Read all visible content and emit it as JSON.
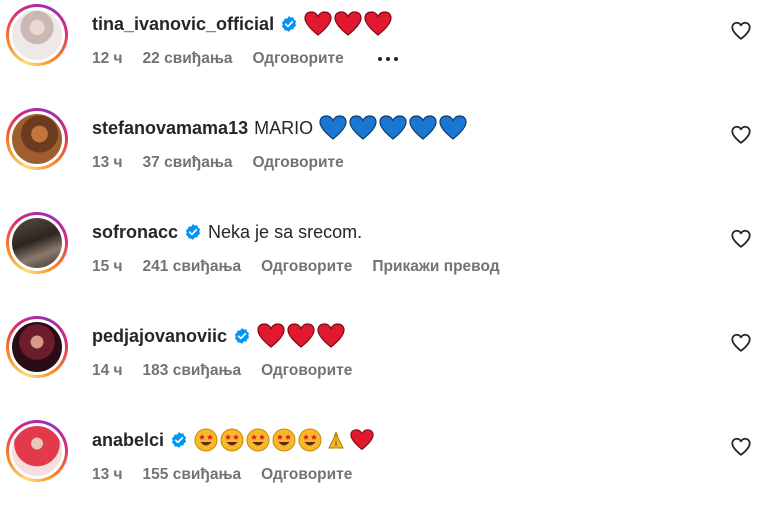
{
  "comments": [
    {
      "username": "tina_ivanovic_official",
      "verified": true,
      "text": "",
      "emojis": [
        "red-heart",
        "red-heart",
        "red-heart"
      ],
      "time": "12 ч",
      "likes": "22 свиђања",
      "reply_label": "Одговорите",
      "has_more": true,
      "translate_label": ""
    },
    {
      "username": "stefanovamama13",
      "verified": false,
      "text": "MARIO",
      "emojis": [
        "blue-heart",
        "blue-heart",
        "blue-heart",
        "blue-heart",
        "blue-heart"
      ],
      "time": "13 ч",
      "likes": "37 свиђања",
      "reply_label": "Одговорите",
      "has_more": false,
      "translate_label": ""
    },
    {
      "username": "sofronacc",
      "verified": true,
      "text": "Neka je sa srecom.",
      "emojis": [],
      "time": "15 ч",
      "likes": "241 свиђања",
      "reply_label": "Одговорите",
      "has_more": false,
      "translate_label": "Прикажи превод"
    },
    {
      "username": "pedjajovanoviic",
      "verified": true,
      "text": "",
      "emojis": [
        "red-heart",
        "red-heart",
        "red-heart"
      ],
      "time": "14 ч",
      "likes": "183 свиђања",
      "reply_label": "Одговорите",
      "has_more": false,
      "translate_label": ""
    },
    {
      "username": "anabelci",
      "verified": true,
      "text": "",
      "emojis": [
        "star-struck",
        "star-struck",
        "star-struck",
        "star-struck",
        "star-struck",
        "folded-hands",
        "red-heart"
      ],
      "time": "13 ч",
      "likes": "155 свиђања",
      "reply_label": "Одговорите",
      "has_more": false,
      "translate_label": ""
    }
  ],
  "colors": {
    "verified_blue": "#0095f6",
    "red_heart": "#e0192f",
    "blue_heart": "#1a78d2",
    "meta_gray": "#737373",
    "text": "#262626"
  }
}
